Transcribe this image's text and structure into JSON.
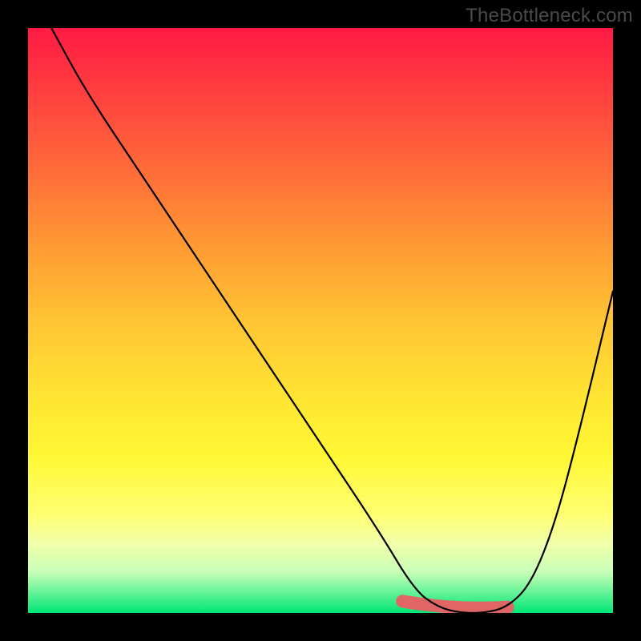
{
  "watermark": "TheBottleneck.com",
  "chart_data": {
    "type": "line",
    "title": "",
    "xlabel": "",
    "ylabel": "",
    "xlim": [
      0,
      100
    ],
    "ylim": [
      0,
      100
    ],
    "grid": false,
    "series": [
      {
        "name": "bottleneck-curve",
        "x": [
          4,
          10,
          20,
          30,
          40,
          50,
          60,
          66,
          70,
          74,
          78,
          82,
          86,
          90,
          94,
          100
        ],
        "y": [
          100,
          89,
          74,
          59,
          44,
          29,
          14,
          4,
          1,
          0,
          0,
          1,
          5,
          15,
          30,
          55
        ]
      }
    ],
    "highlight": {
      "name": "optimal-range",
      "x": [
        64,
        82
      ],
      "y": [
        2,
        1
      ]
    },
    "background_gradient": {
      "direction": "vertical",
      "stops": [
        {
          "pos": 0.0,
          "color": "#ff1a44"
        },
        {
          "pos": 0.25,
          "color": "#ff6e39"
        },
        {
          "pos": 0.5,
          "color": "#ffc433"
        },
        {
          "pos": 0.75,
          "color": "#fff733"
        },
        {
          "pos": 1.0,
          "color": "#00e676"
        }
      ]
    }
  }
}
